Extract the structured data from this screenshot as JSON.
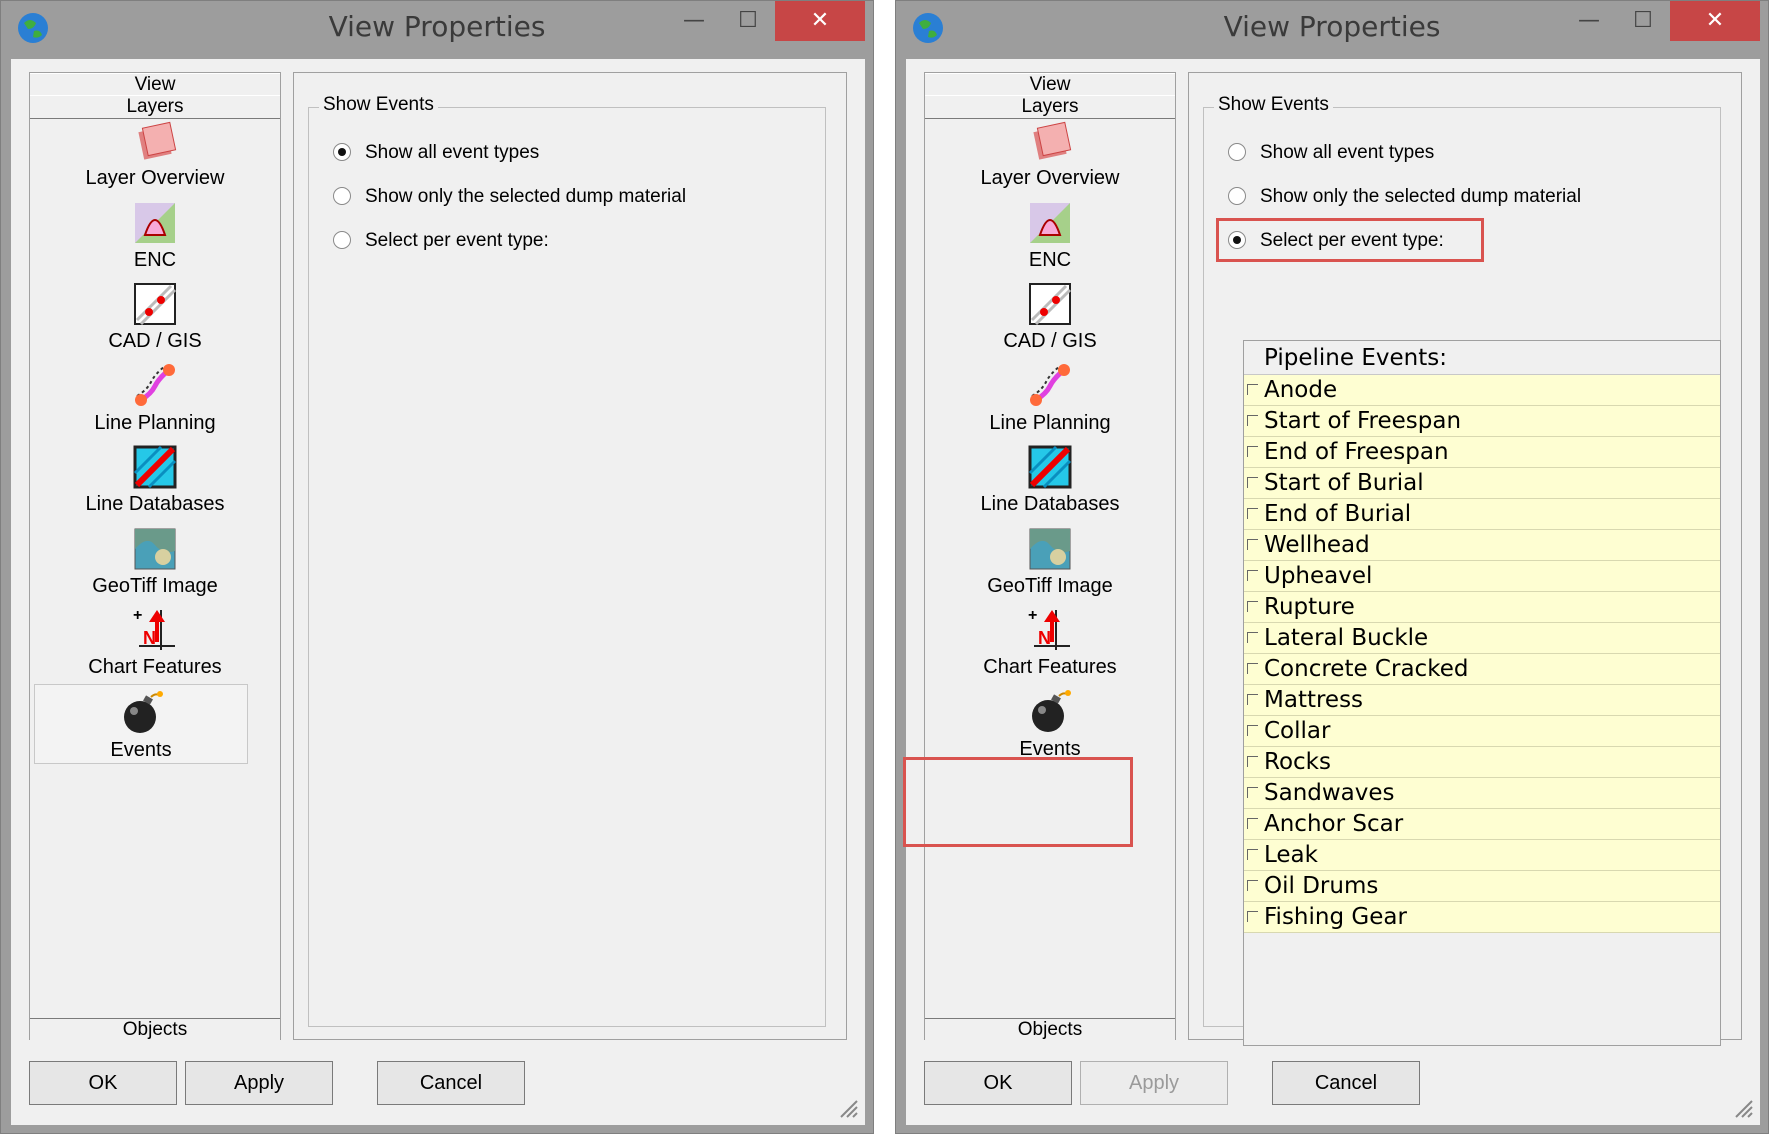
{
  "left_window": {
    "title": "View Properties",
    "controls": {
      "minimize": "—",
      "maximize": "☐",
      "close": "✕"
    },
    "nav": {
      "header_view": "View",
      "header_layers": "Layers",
      "footer_objects": "Objects",
      "items": [
        {
          "label": "Layer Overview",
          "icon": "layer-overview-icon"
        },
        {
          "label": "ENC",
          "icon": "enc-icon"
        },
        {
          "label": "CAD / GIS",
          "icon": "cad-gis-icon"
        },
        {
          "label": "Line Planning",
          "icon": "line-planning-icon"
        },
        {
          "label": "Line Databases",
          "icon": "line-databases-icon"
        },
        {
          "label": "GeoTiff Image",
          "icon": "geotiff-icon"
        },
        {
          "label": "Chart Features",
          "icon": "chart-features-icon"
        },
        {
          "label": "Events",
          "icon": "bomb-icon",
          "selected": true
        }
      ]
    },
    "group_title": "Show Events",
    "radios": [
      {
        "label": "Show all event types",
        "checked": true
      },
      {
        "label": "Show only the selected dump material",
        "checked": false
      },
      {
        "label": "Select per event type:",
        "checked": false
      }
    ],
    "buttons": {
      "ok": "OK",
      "apply": "Apply",
      "cancel": "Cancel",
      "apply_disabled": false
    }
  },
  "right_window": {
    "title": "View Properties",
    "controls": {
      "minimize": "—",
      "maximize": "☐",
      "close": "✕"
    },
    "nav": {
      "header_view": "View",
      "header_layers": "Layers",
      "footer_objects": "Objects",
      "items": [
        {
          "label": "Layer Overview",
          "icon": "layer-overview-icon"
        },
        {
          "label": "ENC",
          "icon": "enc-icon"
        },
        {
          "label": "CAD / GIS",
          "icon": "cad-gis-icon"
        },
        {
          "label": "Line Planning",
          "icon": "line-planning-icon"
        },
        {
          "label": "Line Databases",
          "icon": "line-databases-icon"
        },
        {
          "label": "GeoTiff Image",
          "icon": "geotiff-icon"
        },
        {
          "label": "Chart Features",
          "icon": "chart-features-icon"
        },
        {
          "label": "Events",
          "icon": "bomb-icon",
          "selected": true
        }
      ]
    },
    "group_title": "Show Events",
    "radios": [
      {
        "label": "Show all event types",
        "checked": false
      },
      {
        "label": "Show only the selected dump material",
        "checked": false
      },
      {
        "label": "Select per event type:",
        "checked": true
      }
    ],
    "event_list": {
      "header": "Pipeline Events:",
      "items": [
        "Anode",
        "Start of Freespan",
        "End of Freespan",
        "Start of Burial",
        "End of Burial",
        "Wellhead",
        "Upheavel",
        "Rupture",
        "Lateral Buckle",
        "Concrete Cracked",
        "Mattress",
        "Collar",
        "Rocks",
        "Sandwaves",
        "Anchor Scar",
        "Leak",
        "Oil Drums",
        "Fishing Gear"
      ]
    },
    "buttons": {
      "ok": "OK",
      "apply": "Apply",
      "cancel": "Cancel",
      "apply_disabled": true
    }
  },
  "colors": {
    "highlight": "#d9534f",
    "list_row_bg": "#fefed2",
    "close_button": "#c74646"
  }
}
